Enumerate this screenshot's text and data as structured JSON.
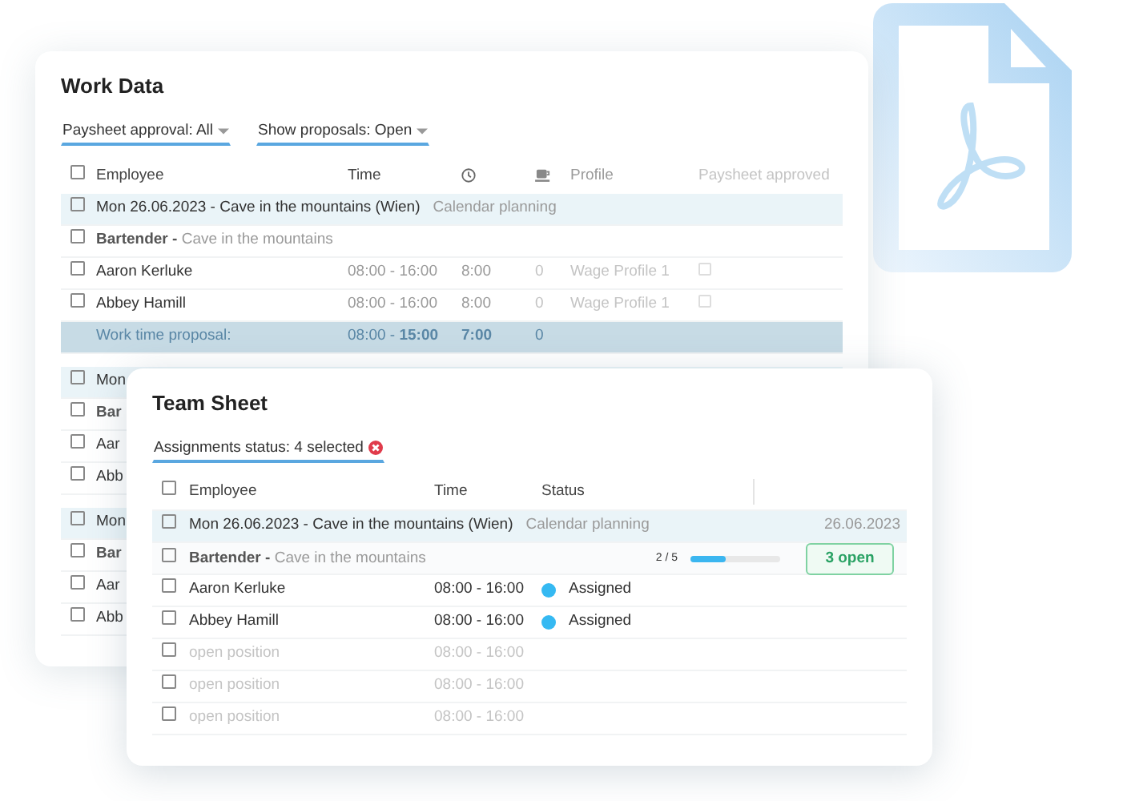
{
  "work_data": {
    "title": "Work Data",
    "filters": [
      {
        "label": "Paysheet approval:",
        "value": "All"
      },
      {
        "label": "Show proposals:",
        "value": "Open"
      }
    ],
    "header": {
      "checked": false,
      "employee": "Employee",
      "time": "Time",
      "profile": "Profile",
      "approved": "Paysheet approved"
    },
    "group": {
      "checked": false,
      "heading": "Mon 26.06.2023 - Cave in the mountains (Wien)",
      "planning": "Calendar planning"
    },
    "role": {
      "checked": false,
      "role": "Bartender -",
      "location": "Cave in the mountains"
    },
    "rows": [
      {
        "checked": false,
        "employee": "Aaron Kerluke",
        "time": "08:00 - 16:00",
        "hours": "8:00",
        "breaks": "0",
        "profile": "Wage Profile 1",
        "approved": false
      },
      {
        "checked": false,
        "employee": "Abbey Hamill",
        "time": "08:00 - 16:00",
        "hours": "8:00",
        "breaks": "0",
        "profile": "Wage Profile 1",
        "approved": false
      }
    ],
    "proposal": {
      "label": "Work time proposal:",
      "time": "08:00 - **15:00**",
      "hours": "7:00",
      "breaks": "0"
    },
    "covered_groups": [
      {
        "checked": false,
        "heading": "Mon",
        "role_checked": false,
        "role": "Bar",
        "rows": [
          {
            "checked": false,
            "employee": "Aar"
          },
          {
            "checked": false,
            "employee": "Abb"
          }
        ]
      },
      {
        "checked": false,
        "heading": "Mon",
        "role_checked": false,
        "role": "Bar",
        "rows": [
          {
            "checked": false,
            "employee": "Aar"
          },
          {
            "checked": false,
            "employee": "Abb"
          }
        ]
      }
    ]
  },
  "team_sheet": {
    "title": "Team Sheet",
    "filter": {
      "label": "Assignments status:",
      "value": "4 selected"
    },
    "header": {
      "checked": false,
      "columns": [
        "Employee",
        "Time",
        "Status"
      ]
    },
    "group": {
      "checked": false,
      "heading": "Mon 26.06.2023 - Cave in the mountains (Wien)",
      "planning": "Calendar planning",
      "date": "26.06.2023"
    },
    "role": {
      "checked": false,
      "role": "Bartender -",
      "location": "Cave in the mountains",
      "progress": "2 / 5",
      "level": 0.4,
      "badge": "3 open"
    },
    "rows": [
      {
        "kind": "assigned",
        "checked": false,
        "employee": "Aaron Kerluke",
        "time": "08:00 - 16:00",
        "status": "Assigned",
        "color": "#35b9f2"
      },
      {
        "kind": "assigned",
        "checked": false,
        "employee": "Abbey Hamill",
        "time": "08:00 - 16:00",
        "status": "Assigned",
        "color": "#35b9f2"
      },
      {
        "kind": "open",
        "checked": false,
        "employee": "open position",
        "time": "08:00 - 16:00"
      },
      {
        "kind": "open",
        "checked": false,
        "employee": "open position",
        "time": "08:00 - 16:00"
      },
      {
        "kind": "open",
        "checked": false,
        "employee": "open position",
        "time": "08:00 - 16:00"
      }
    ]
  }
}
